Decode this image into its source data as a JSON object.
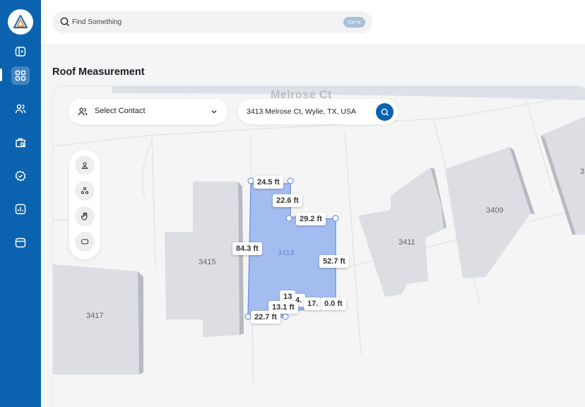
{
  "header": {
    "search_placeholder": "Find Something",
    "search_shortcut": "Ctrl K"
  },
  "page": {
    "title": "Roof Measurement"
  },
  "map": {
    "contact_label": "Select Contact",
    "address_value": "3413 Melrose Ct, Wylie, TX, USA",
    "street_label": "Melrose Ct",
    "lots": [
      "3417",
      "3415",
      "3413",
      "3411",
      "3409",
      "3"
    ],
    "measurements": [
      "24.5 ft",
      "22.6 ft",
      "29.2 ft",
      "84.3 ft",
      "52.7 ft",
      "13",
      "4.",
      "13.1 ft",
      "17.",
      "0.0 ft",
      "22.7 ft"
    ]
  },
  "colors": {
    "brand": "#0b63b0",
    "roof_fill": "#a4bdf0",
    "roof_stroke": "#6f95e8"
  }
}
